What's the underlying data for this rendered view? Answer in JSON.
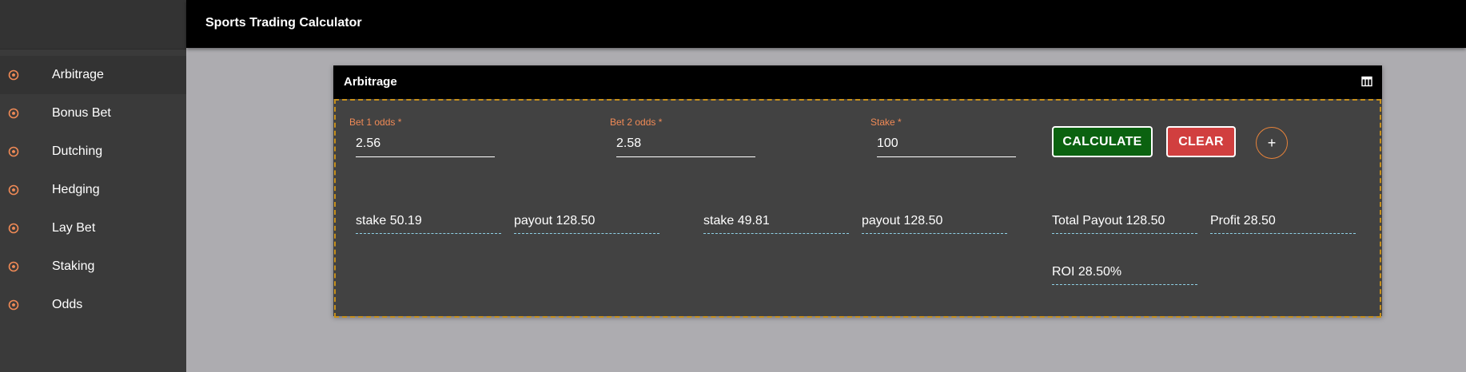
{
  "app": {
    "title": "Sports Trading Calculator"
  },
  "sidebar": {
    "items": [
      {
        "label": "Arbitrage",
        "icon": "soccer-ball-icon",
        "active": true
      },
      {
        "label": "Bonus Bet",
        "icon": "soccer-ball-icon",
        "active": false
      },
      {
        "label": "Dutching",
        "icon": "soccer-ball-icon",
        "active": false
      },
      {
        "label": "Hedging",
        "icon": "soccer-ball-icon",
        "active": false
      },
      {
        "label": "Lay Bet",
        "icon": "soccer-ball-icon",
        "active": false
      },
      {
        "label": "Staking",
        "icon": "soccer-ball-icon",
        "active": false
      },
      {
        "label": "Odds",
        "icon": "soccer-ball-icon",
        "active": false
      }
    ]
  },
  "card": {
    "title": "Arbitrage",
    "header_icon": "table-icon",
    "fields": {
      "bet1": {
        "label": "Bet 1 odds *",
        "value": "2.56"
      },
      "bet2": {
        "label": "Bet 2 odds *",
        "value": "2.58"
      },
      "stake": {
        "label": "Stake *",
        "value": "100"
      }
    },
    "buttons": {
      "calculate": "CALCULATE",
      "clear": "CLEAR",
      "add": "+"
    },
    "results": {
      "stake1": "stake 50.19",
      "payout1": "payout 128.50",
      "stake2": "stake 49.81",
      "payout2": "payout 128.50",
      "total_payout": "Total Payout 128.50",
      "profit": "Profit 28.50",
      "roi": "ROI 28.50%"
    }
  },
  "colors": {
    "accent": "#f08a56",
    "calculate": "#0b6210",
    "clear": "#d13f3f",
    "border_dashed": "#c7901c",
    "result_underline": "#8fd1e6"
  }
}
